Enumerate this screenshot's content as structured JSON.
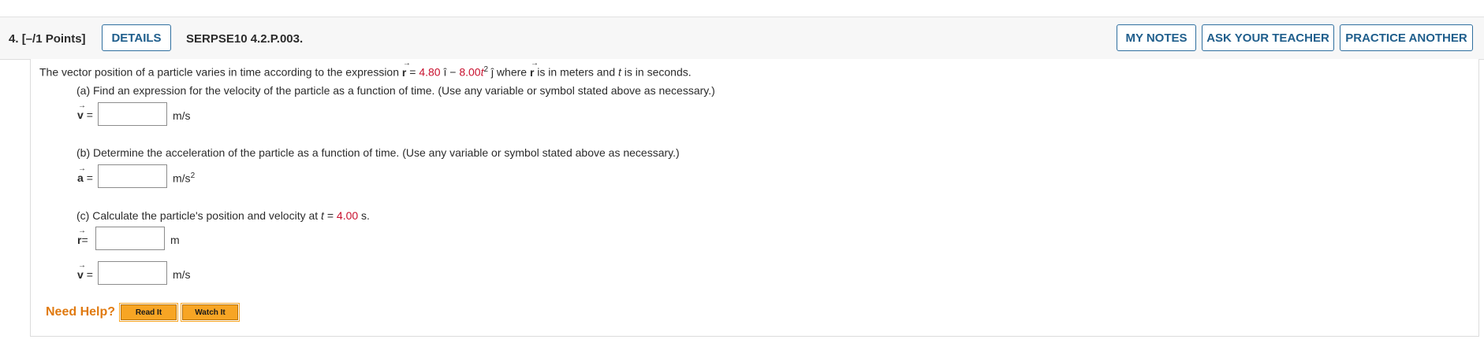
{
  "question": {
    "number": "4.",
    "points": "[–/1 Points]",
    "details_label": "DETAILS",
    "code": "SERPSE10 4.2.P.003."
  },
  "header_buttons": {
    "my_notes": "MY NOTES",
    "ask_teacher": "ASK YOUR TEACHER",
    "practice_another": "PRACTICE ANOTHER"
  },
  "problem": {
    "intro_before": "The vector position of a particle varies in time according to the expression ",
    "r_symbol": "r",
    "equals": " = ",
    "coef1": "4.80",
    "i_hat": " î",
    "minus": " − ",
    "coef2": "8.00",
    "t_var": "t",
    "sq": "2",
    "j_hat": " ĵ",
    "where": " where ",
    "r_symbol2": "r",
    "tail": " is in meters and ",
    "t_var2": "t",
    "tail2": " is in seconds."
  },
  "parts": {
    "a_prompt": "(a) Find an expression for the velocity of the particle as a function of time. (Use any variable or symbol stated above as necessary.)",
    "a_symbol": "v",
    "a_eq": "=",
    "a_unit": "m/s",
    "b_prompt": "(b) Determine the acceleration of the particle as a function of time. (Use any variable or symbol stated above as necessary.)",
    "b_symbol": "a",
    "b_eq": "=",
    "b_unit": "m/s",
    "b_unit_exp": "2",
    "c_prompt_before": "(c) Calculate the particle's position and velocity at ",
    "c_t": "t",
    "c_eq": " = ",
    "c_value": "4.00",
    "c_unit_after": " s.",
    "c_r_symbol": "r",
    "c_r_eq": "=",
    "c_r_unit": "m",
    "c_v_symbol": "v",
    "c_v_eq": "=",
    "c_v_unit": "m/s"
  },
  "help": {
    "label": "Need Help?",
    "read_it": "Read It",
    "watch_it": "Watch It"
  },
  "colors": {
    "accent_blue": "#1f5e8c",
    "given_value_red": "#c8102e",
    "help_orange": "#e07a10",
    "help_button": "#f7a524"
  }
}
